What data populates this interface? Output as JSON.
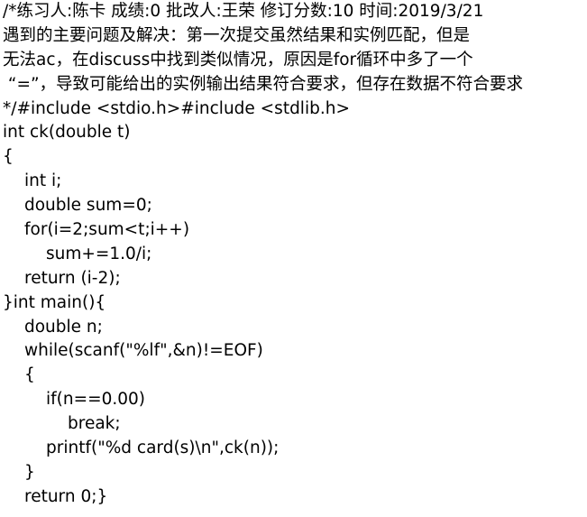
{
  "header_lines": [
    "/*练习人:陈卡 成绩:0 批改人:王荣 修订分数:10 时间:2019/3/21",
    "遇到的主要问题及解决：第一次提交虽然结果和实例匹配，但是",
    "无法ac，在discuss中找到类似情况，原因是for循环中多了一个",
    " “=”，导致可能给出的实例输出结果符合要求，但存在数据不符合要求"
  ],
  "code_lines": [
    "*/#include <stdio.h>#include <stdlib.h>",
    "int ck(double t)",
    "{",
    "int i;",
    "double sum=0;",
    "for(i=2;sum<t;i++)",
    "sum+=1.0/i;",
    "return (i-2);",
    "}int main(){",
    "double n;",
    "while(scanf(\"%lf\",&n)!=EOF)",
    "{",
    "if(n==0.00)",
    "break;",
    "printf(\"%d card(s)\\n\",ck(n));",
    "}",
    "return 0;}"
  ]
}
